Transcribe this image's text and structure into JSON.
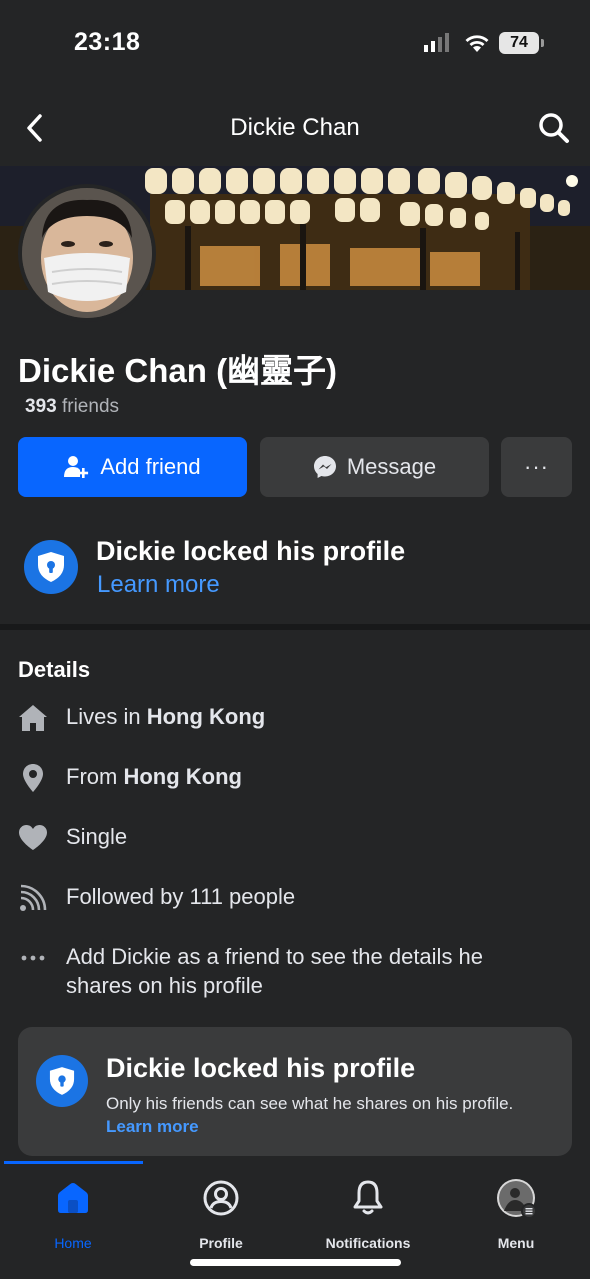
{
  "status_bar": {
    "time": "23:18",
    "battery": "74"
  },
  "nav": {
    "title": "Dickie Chan",
    "back_icon": "chevron-left-icon",
    "search_icon": "search-icon"
  },
  "profile": {
    "name": "Dickie Chan (幽靈子)",
    "friends_count": "393",
    "friends_label": " friends"
  },
  "actions": {
    "add_friend": "Add friend",
    "message": "Message",
    "more": "···"
  },
  "lock_notice": {
    "title": "Dickie locked his profile",
    "link": "Learn more"
  },
  "details": {
    "title": "Details",
    "items": [
      {
        "icon": "home-icon",
        "prefix": "Lives in ",
        "bold": "Hong Kong"
      },
      {
        "icon": "location-pin-icon",
        "prefix": "From ",
        "bold": "Hong Kong"
      },
      {
        "icon": "heart-icon",
        "prefix": "Single",
        "bold": ""
      },
      {
        "icon": "rss-feed-icon",
        "prefix": "Followed by 111 people",
        "bold": ""
      },
      {
        "icon": "more-dots-icon",
        "prefix": "Add Dickie as a friend to see the details he shares on his profile",
        "bold": ""
      }
    ]
  },
  "lock_card": {
    "title": "Dickie locked his profile",
    "text": "Only his friends can see what he shares on his profile. ",
    "link": "Learn more"
  },
  "tabs": [
    {
      "label": "Home",
      "icon": "home-icon",
      "active": true
    },
    {
      "label": "Profile",
      "icon": "profile-icon",
      "active": false
    },
    {
      "label": "Notifications",
      "icon": "bell-icon",
      "active": false
    },
    {
      "label": "Menu",
      "icon": "avatar-menu-icon",
      "active": false
    }
  ],
  "colors": {
    "accent": "#0866ff",
    "link": "#4599ff",
    "background": "#242526",
    "button_dark": "#3a3b3c"
  }
}
